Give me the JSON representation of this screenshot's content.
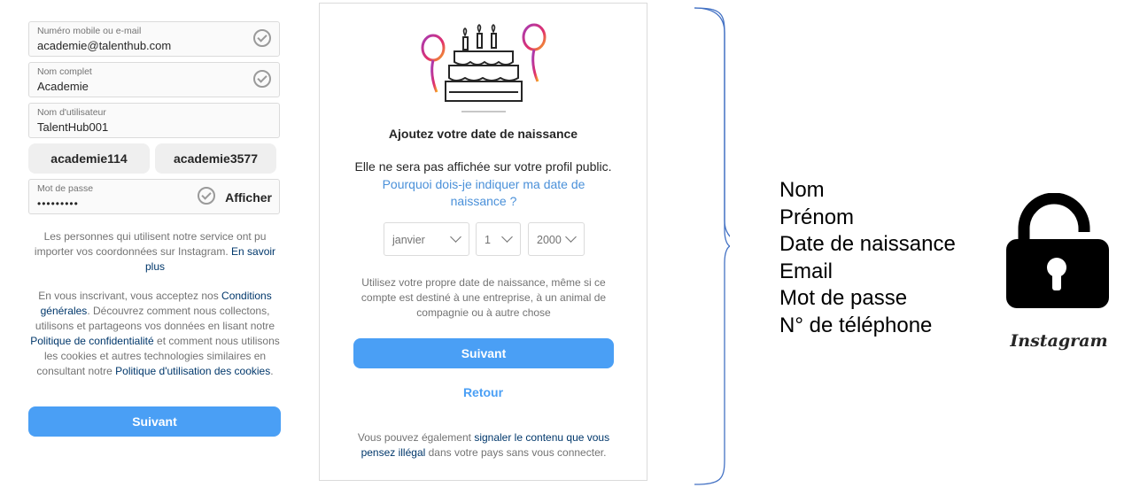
{
  "signup": {
    "fields": [
      {
        "label": "Numéro mobile ou e-mail",
        "value": "academie@talenthub.com"
      },
      {
        "label": "Nom complet",
        "value": "Academie"
      },
      {
        "label": "Nom d'utilisateur",
        "value": "TalentHub001"
      }
    ],
    "username_suggestions": [
      "academie114",
      "academie3577"
    ],
    "password": {
      "label": "Mot de passe",
      "value": "•••••••••",
      "show_label": "Afficher"
    },
    "info_text": "Les personnes qui utilisent notre service ont pu importer vos coordonnées sur Instagram.",
    "info_link": "En savoir plus",
    "terms": {
      "p1": "En vous inscrivant, vous acceptez nos",
      "link1": "Conditions générales",
      "p2": ". Découvrez comment nous collectons, utilisons et partageons vos données en lisant notre",
      "link2": "Politique de confidentialité",
      "p3": "et comment nous utilisons les cookies et autres technologies similaires en consultant notre",
      "link3": "Politique d'utilisation des cookies",
      "p4": "."
    },
    "next_label": "Suivant"
  },
  "birthday": {
    "title": "Ajoutez votre date de naissance",
    "subtitle": "Elle ne sera pas affichée sur votre profil public.",
    "why_link": "Pourquoi dois-je indiquer ma date de naissance ?",
    "month": "janvier",
    "day": "1",
    "year": "2000",
    "note": "Utilisez votre propre date de naissance, même si ce compte est destiné à une entreprise, à un animal de compagnie ou à autre chose",
    "next_label": "Suivant",
    "back_label": "Retour",
    "footer_p1": "Vous pouvez également",
    "footer_link": "signaler le contenu que vous pensez illégal",
    "footer_p2": "dans votre pays sans vous connecter."
  },
  "summary": {
    "items": [
      "Nom",
      "Prénom",
      "Date de naissance",
      "Email",
      "Mot de passe",
      "N° de téléphone"
    ]
  },
  "brand": {
    "name": "Instagram",
    "icon": "unlocked-padlock-icon"
  },
  "colors": {
    "accent": "#4a9ff5",
    "link": "#00376b",
    "link_blue": "#4a90d9",
    "brace": "#4472c4"
  }
}
